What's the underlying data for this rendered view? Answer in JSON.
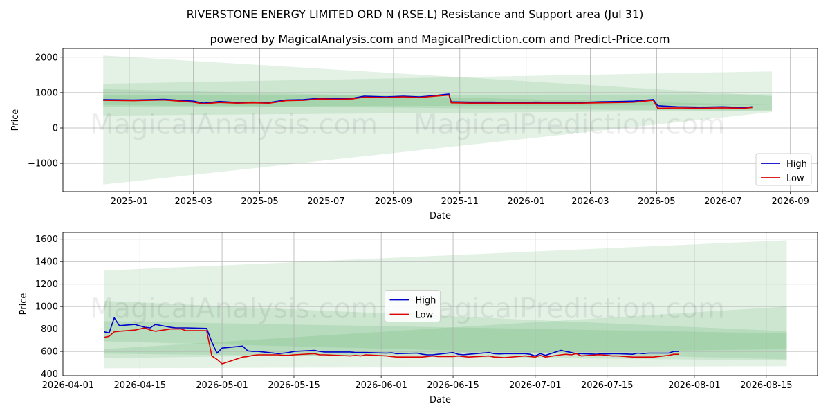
{
  "title": "RIVERSTONE ENERGY LIMITED ORD N (RSE.L) Resistance and Support area (Jul 31)",
  "subtitle": "powered by MagicalAnalysis.com and MagicalPrediction.com and Predict-Price.com",
  "watermarks": [
    "MagicalAnalysis.com",
    "MagicalPrediction.com"
  ],
  "colors": {
    "high": "#0000cc",
    "low": "#dd0000",
    "band": "#2e9e3a"
  },
  "chart_data": [
    {
      "type": "line",
      "xlabel": "Date",
      "ylabel": "Price",
      "x_ticks": [
        "2025-01",
        "2025-03",
        "2025-05",
        "2025-07",
        "2025-09",
        "2025-11",
        "2026-01",
        "2026-03",
        "2026-05",
        "2026-07",
        "2026-09"
      ],
      "y_ticks": [
        "−1000",
        "0",
        "1000",
        "2000"
      ],
      "ylim": [
        -1800,
        2250
      ],
      "grid": true,
      "legend": {
        "placement": "lower-right",
        "entries": [
          "High",
          "Low"
        ]
      },
      "series": [
        {
          "name": "High",
          "x": [
            "2024-12-08",
            "2025-01-05",
            "2025-02-02",
            "2025-03-01",
            "2025-03-10",
            "2025-03-25",
            "2025-04-10",
            "2025-04-25",
            "2025-05-10",
            "2025-05-25",
            "2025-06-10",
            "2025-06-25",
            "2025-07-10",
            "2025-07-25",
            "2025-08-05",
            "2025-08-25",
            "2025-09-10",
            "2025-09-25",
            "2025-10-10",
            "2025-10-22",
            "2025-10-24",
            "2025-11-10",
            "2025-12-01",
            "2025-12-20",
            "2026-01-10",
            "2026-02-01",
            "2026-02-20",
            "2026-03-10",
            "2026-03-30",
            "2026-04-10",
            "2026-04-28",
            "2026-05-02",
            "2026-05-20",
            "2026-06-10",
            "2026-07-01",
            "2026-07-20",
            "2026-07-28"
          ],
          "y": [
            800,
            790,
            810,
            760,
            700,
            750,
            720,
            730,
            720,
            790,
            800,
            840,
            830,
            840,
            900,
            880,
            900,
            880,
            920,
            960,
            740,
            730,
            730,
            720,
            730,
            720,
            720,
            740,
            750,
            760,
            805,
            630,
            600,
            590,
            600,
            580,
            600
          ]
        },
        {
          "name": "Low",
          "x": [
            "2024-12-08",
            "2025-01-05",
            "2025-02-02",
            "2025-03-01",
            "2025-03-10",
            "2025-03-25",
            "2025-04-10",
            "2025-04-25",
            "2025-05-10",
            "2025-05-25",
            "2025-06-10",
            "2025-06-25",
            "2025-07-10",
            "2025-07-25",
            "2025-08-05",
            "2025-08-25",
            "2025-09-10",
            "2025-09-25",
            "2025-10-10",
            "2025-10-22",
            "2025-10-24",
            "2025-11-10",
            "2025-12-01",
            "2025-12-20",
            "2026-01-10",
            "2026-02-01",
            "2026-02-20",
            "2026-03-10",
            "2026-03-30",
            "2026-04-10",
            "2026-04-28",
            "2026-05-02",
            "2026-05-20",
            "2026-06-10",
            "2026-07-01",
            "2026-07-20",
            "2026-07-28"
          ],
          "y": [
            780,
            770,
            790,
            730,
            680,
            720,
            700,
            710,
            700,
            770,
            780,
            820,
            810,
            820,
            870,
            860,
            880,
            860,
            900,
            930,
            710,
            700,
            700,
            700,
            700,
            700,
            700,
            710,
            720,
            730,
            780,
            560,
            570,
            560,
            570,
            560,
            580
          ]
        }
      ],
      "bands": [
        {
          "x": [
            "2024-12-08",
            "2026-08-15"
          ],
          "upper": [
            2050,
            900
          ],
          "lower": [
            -1600,
            450
          ]
        },
        {
          "x": [
            "2024-12-08",
            "2026-08-15"
          ],
          "upper": [
            1250,
            1600
          ],
          "lower": [
            350,
            500
          ]
        },
        {
          "x": [
            "2024-12-08",
            "2026-08-15"
          ],
          "upper": [
            920,
            950
          ],
          "lower": [
            600,
            650
          ]
        },
        {
          "x": [
            "2024-12-08",
            "2026-08-15"
          ],
          "upper": [
            1100,
            650
          ],
          "lower": [
            650,
            480
          ]
        }
      ]
    },
    {
      "type": "line",
      "xlabel": "Date",
      "ylabel": "Price",
      "x_ticks": [
        "2026-04-01",
        "2026-04-15",
        "2026-05-01",
        "2026-05-15",
        "2026-06-01",
        "2026-06-15",
        "2026-07-01",
        "2026-07-15",
        "2026-08-01",
        "2026-08-15"
      ],
      "y_ticks": [
        "400",
        "600",
        "800",
        "1000",
        "1200",
        "1400",
        "1600"
      ],
      "ylim": [
        385,
        1660
      ],
      "grid": true,
      "legend": {
        "placement": "center",
        "entries": [
          "High",
          "Low"
        ]
      },
      "series": [
        {
          "name": "High",
          "x": [
            "2026-04-08",
            "2026-04-09",
            "2026-04-10",
            "2026-04-11",
            "2026-04-14",
            "2026-04-16",
            "2026-04-17",
            "2026-04-18",
            "2026-04-21",
            "2026-04-22",
            "2026-04-23",
            "2026-04-24",
            "2026-04-28",
            "2026-04-29",
            "2026-04-30",
            "2026-05-01",
            "2026-05-05",
            "2026-05-06",
            "2026-05-07",
            "2026-05-08",
            "2026-05-12",
            "2026-05-13",
            "2026-05-14",
            "2026-05-15",
            "2026-05-19",
            "2026-05-20",
            "2026-05-21",
            "2026-05-26",
            "2026-05-27",
            "2026-05-28",
            "2026-05-29",
            "2026-06-02",
            "2026-06-03",
            "2026-06-04",
            "2026-06-08",
            "2026-06-09",
            "2026-06-10",
            "2026-06-11",
            "2026-06-12",
            "2026-06-15",
            "2026-06-16",
            "2026-06-17",
            "2026-06-18",
            "2026-06-22",
            "2026-06-23",
            "2026-06-24",
            "2026-06-25",
            "2026-06-29",
            "2026-06-30",
            "2026-07-01",
            "2026-07-02",
            "2026-07-03",
            "2026-07-06",
            "2026-07-07",
            "2026-07-08",
            "2026-07-09",
            "2026-07-10",
            "2026-07-13",
            "2026-07-14",
            "2026-07-15",
            "2026-07-16",
            "2026-07-17",
            "2026-07-20",
            "2026-07-21",
            "2026-07-22",
            "2026-07-23",
            "2026-07-24",
            "2026-07-27",
            "2026-07-28",
            "2026-07-29"
          ],
          "y": [
            775,
            765,
            900,
            830,
            840,
            815,
            810,
            840,
            815,
            810,
            810,
            810,
            805,
            685,
            585,
            630,
            648,
            605,
            600,
            600,
            580,
            585,
            590,
            600,
            610,
            600,
            595,
            595,
            590,
            590,
            590,
            585,
            588,
            580,
            585,
            575,
            570,
            570,
            575,
            590,
            575,
            570,
            575,
            590,
            580,
            578,
            580,
            580,
            575,
            560,
            580,
            565,
            610,
            600,
            590,
            580,
            580,
            575,
            580,
            578,
            580,
            580,
            575,
            585,
            580,
            585,
            585,
            585,
            600,
            600
          ]
        },
        {
          "name": "Low",
          "x": [
            "2026-04-08",
            "2026-04-09",
            "2026-04-10",
            "2026-04-11",
            "2026-04-14",
            "2026-04-16",
            "2026-04-17",
            "2026-04-18",
            "2026-04-21",
            "2026-04-22",
            "2026-04-23",
            "2026-04-24",
            "2026-04-28",
            "2026-04-29",
            "2026-04-30",
            "2026-05-01",
            "2026-05-05",
            "2026-05-06",
            "2026-05-07",
            "2026-05-08",
            "2026-05-12",
            "2026-05-13",
            "2026-05-14",
            "2026-05-15",
            "2026-05-19",
            "2026-05-20",
            "2026-05-21",
            "2026-05-26",
            "2026-05-27",
            "2026-05-28",
            "2026-05-29",
            "2026-06-02",
            "2026-06-03",
            "2026-06-04",
            "2026-06-08",
            "2026-06-09",
            "2026-06-10",
            "2026-06-11",
            "2026-06-12",
            "2026-06-15",
            "2026-06-16",
            "2026-06-17",
            "2026-06-18",
            "2026-06-22",
            "2026-06-23",
            "2026-06-24",
            "2026-06-25",
            "2026-06-29",
            "2026-06-30",
            "2026-07-01",
            "2026-07-02",
            "2026-07-03",
            "2026-07-06",
            "2026-07-07",
            "2026-07-08",
            "2026-07-09",
            "2026-07-10",
            "2026-07-13",
            "2026-07-14",
            "2026-07-15",
            "2026-07-16",
            "2026-07-17",
            "2026-07-20",
            "2026-07-21",
            "2026-07-22",
            "2026-07-23",
            "2026-07-24",
            "2026-07-27",
            "2026-07-28",
            "2026-07-29"
          ],
          "y": [
            725,
            735,
            775,
            780,
            790,
            810,
            790,
            780,
            800,
            800,
            800,
            785,
            785,
            560,
            530,
            490,
            550,
            555,
            565,
            570,
            570,
            565,
            565,
            570,
            580,
            570,
            570,
            560,
            565,
            560,
            570,
            560,
            555,
            550,
            550,
            550,
            555,
            560,
            555,
            555,
            560,
            555,
            550,
            560,
            550,
            548,
            545,
            560,
            555,
            550,
            565,
            550,
            570,
            575,
            570,
            580,
            560,
            570,
            570,
            565,
            560,
            560,
            550,
            550,
            550,
            550,
            550,
            565,
            575,
            575
          ]
        }
      ],
      "bands": [
        {
          "x": [
            "2026-04-08",
            "2026-08-19"
          ],
          "upper": [
            1320,
            1590
          ],
          "lower": [
            450,
            470
          ]
        },
        {
          "x": [
            "2026-04-08",
            "2026-08-19"
          ],
          "upper": [
            1050,
            780
          ],
          "lower": [
            690,
            530
          ]
        },
        {
          "x": [
            "2026-04-08",
            "2026-08-19"
          ],
          "upper": [
            620,
            1000
          ],
          "lower": [
            540,
            620
          ]
        },
        {
          "x": [
            "2026-04-08",
            "2026-08-19"
          ],
          "upper": [
            870,
            760
          ],
          "lower": [
            580,
            520
          ]
        }
      ]
    }
  ]
}
